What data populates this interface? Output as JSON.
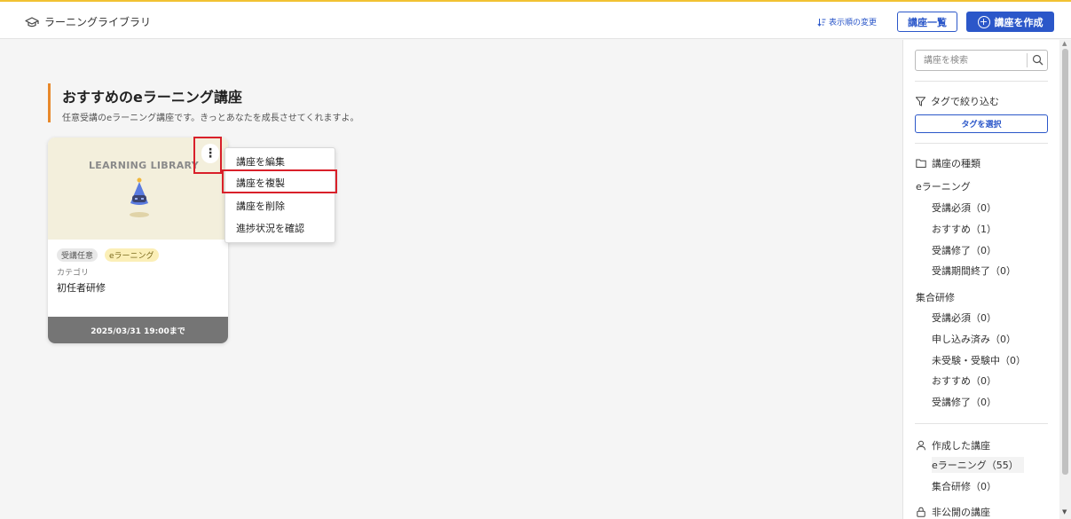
{
  "header": {
    "app_title": "ラーニングライブラリ",
    "sort_label": "表示順の変更",
    "list_button": "講座一覧",
    "create_button": "講座を作成"
  },
  "section": {
    "title": "おすすめのeラーニング講座",
    "description": "任意受講のeラーニング講座です。きっとあなたを成長させてくれますよ。"
  },
  "card": {
    "thumbnail_text": "LEARNING LIBRARY",
    "tags": [
      "受講任意",
      "eラーニング"
    ],
    "category_label": "カテゴリ",
    "category_value": "初任者研修",
    "deadline": "2025/03/31 19:00まで"
  },
  "context_menu": {
    "items": [
      "講座を編集",
      "講座を複製",
      "講座を削除",
      "進捗状況を確認"
    ],
    "highlighted": "講座を複製"
  },
  "sidebar": {
    "search_placeholder": "講座を検索",
    "filter_title": "タグで絞り込む",
    "tag_select_button": "タグを選択",
    "course_type_title": "講座の種類",
    "elearning_group": "eラーニング",
    "elearning_items": [
      "受講必須（0）",
      "おすすめ（1）",
      "受講修了（0）",
      "受講期間終了（0）"
    ],
    "group_training_group": "集合研修",
    "group_training_items": [
      "受講必須（0）",
      "申し込み済み（0）",
      "未受験・受験中（0）",
      "おすすめ（0）",
      "受講修了（0）"
    ],
    "created_title": "作成した講座",
    "created_items": [
      "eラーニング（55）",
      "集合研修（0）"
    ],
    "private_title": "非公開の講座"
  },
  "colors": {
    "accent_blue": "#2b57c9",
    "title_bar_orange": "#e8892b",
    "highlight_red": "#d9202a",
    "top_line_yellow": "#f1c232"
  }
}
